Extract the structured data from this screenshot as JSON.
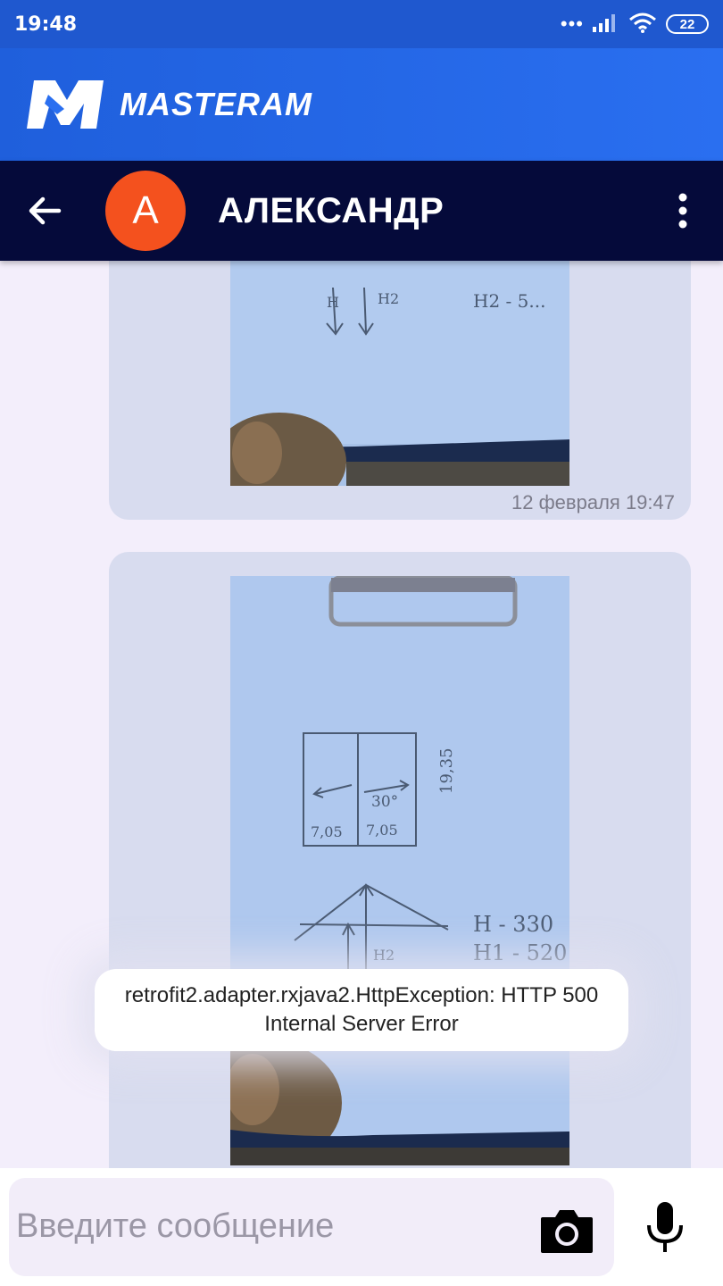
{
  "status_bar": {
    "time": "19:48",
    "signal_dots": "•••",
    "battery": "22"
  },
  "brand": {
    "name": "MASTERAM"
  },
  "header": {
    "avatar_letter": "A",
    "contact_name": "АЛЕКСАНДР"
  },
  "messages": [
    {
      "timestamp": "12 февраля 19:47"
    },
    {
      "timestamp": ""
    }
  ],
  "photo_notes": {
    "h_left": "H",
    "h2": "H2",
    "angle": "30°",
    "dim_left": "7,05",
    "dim_right": "7,05",
    "height": "19,35",
    "h_value": "H - 330",
    "h1_value": "H1 - 520",
    "h2_value": "H2 - 5..."
  },
  "toast": {
    "text": "retrofit2.adapter.rxjava2.HttpException: HTTP 500 Internal Server Error"
  },
  "composer": {
    "placeholder": "Введите сообщение"
  },
  "colors": {
    "status_bar": "#1f58cf",
    "brand_bar": "#2a6ff0",
    "header": "#050a3a",
    "avatar": "#f4511e",
    "bubble": "#d8dcef",
    "background": "#f3eefb"
  }
}
